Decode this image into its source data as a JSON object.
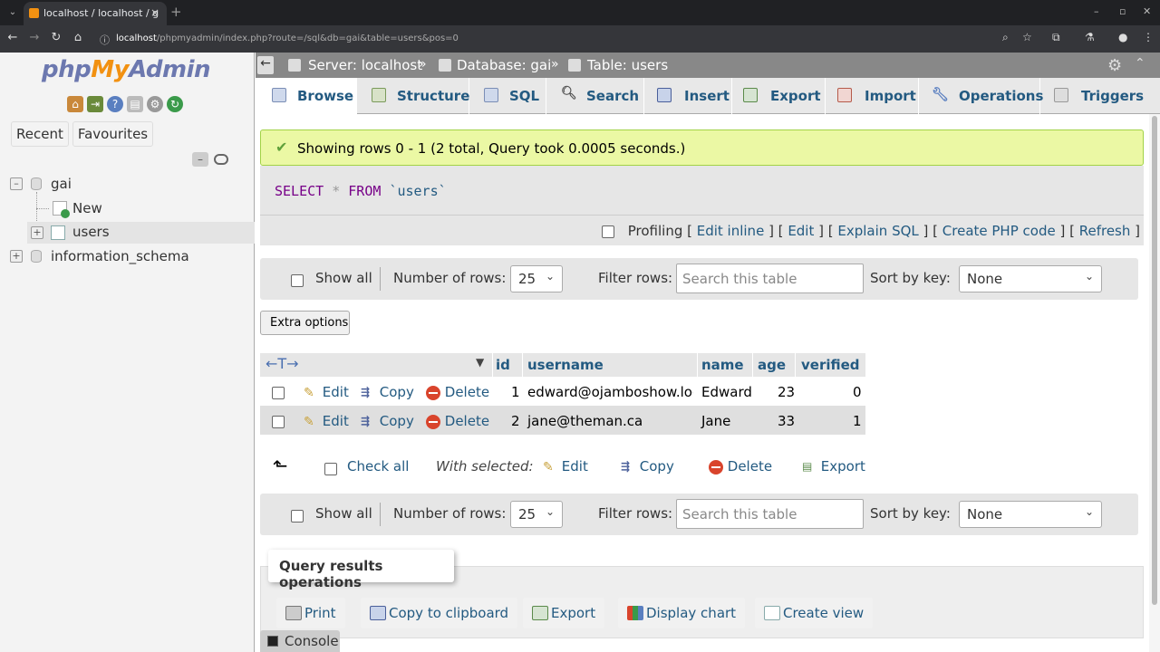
{
  "browser": {
    "tab_title": "localhost / localhost / g",
    "url_host": "localhost",
    "url_path": "/phpmyadmin/index.php?route=/sql&db=gai&table=users&pos=0"
  },
  "nav": {
    "logo_php": "php",
    "logo_my": "My",
    "logo_admin": "Admin",
    "recent": "Recent",
    "favourites": "Favourites",
    "tree": {
      "db1": "gai",
      "new": "New",
      "table": "users",
      "db2": "information_schema"
    }
  },
  "breadcrumb": {
    "server": "Server: localhost",
    "database": "Database: gai",
    "table": "Table: users",
    "separator": "»"
  },
  "tabs": [
    "Browse",
    "Structure",
    "SQL",
    "Search",
    "Insert",
    "Export",
    "Import",
    "Operations",
    "Triggers"
  ],
  "success_message": "Showing rows 0 - 1 (2 total, Query took 0.0005 seconds.)",
  "sql": {
    "select": "SELECT",
    "star": "*",
    "from": "FROM",
    "table": "`users`"
  },
  "profiling": {
    "label": "Profiling",
    "edit_inline": "Edit inline",
    "edit": "Edit",
    "explain": "Explain SQL",
    "php": "Create PHP code",
    "refresh": "Refresh"
  },
  "pager": {
    "show_all": "Show all",
    "rows_label": "Number of rows:",
    "rows_value": "25",
    "filter_label": "Filter rows:",
    "filter_placeholder": "Search this table",
    "sort_label": "Sort by key:",
    "sort_value": "None"
  },
  "extra_options": "Extra options",
  "table": {
    "columns": [
      "id",
      "username",
      "name",
      "age",
      "verified"
    ],
    "action_edit": "Edit",
    "action_copy": "Copy",
    "action_delete": "Delete",
    "rows": [
      {
        "id": "1",
        "username": "edward@ojamboshow.loca",
        "name": "Edward",
        "age": "23",
        "verified": "0"
      },
      {
        "id": "2",
        "username": "jane@theman.ca",
        "name": "Jane",
        "age": "33",
        "verified": "1"
      }
    ]
  },
  "bulk": {
    "check_all": "Check all",
    "with_selected": "With selected:",
    "edit": "Edit",
    "copy": "Copy",
    "delete": "Delete",
    "export": "Export"
  },
  "query_ops": {
    "legend": "Query results operations",
    "print": "Print",
    "copy_clipboard": "Copy to clipboard",
    "export": "Export",
    "display_chart": "Display chart",
    "create_view": "Create view"
  },
  "console": "Console"
}
